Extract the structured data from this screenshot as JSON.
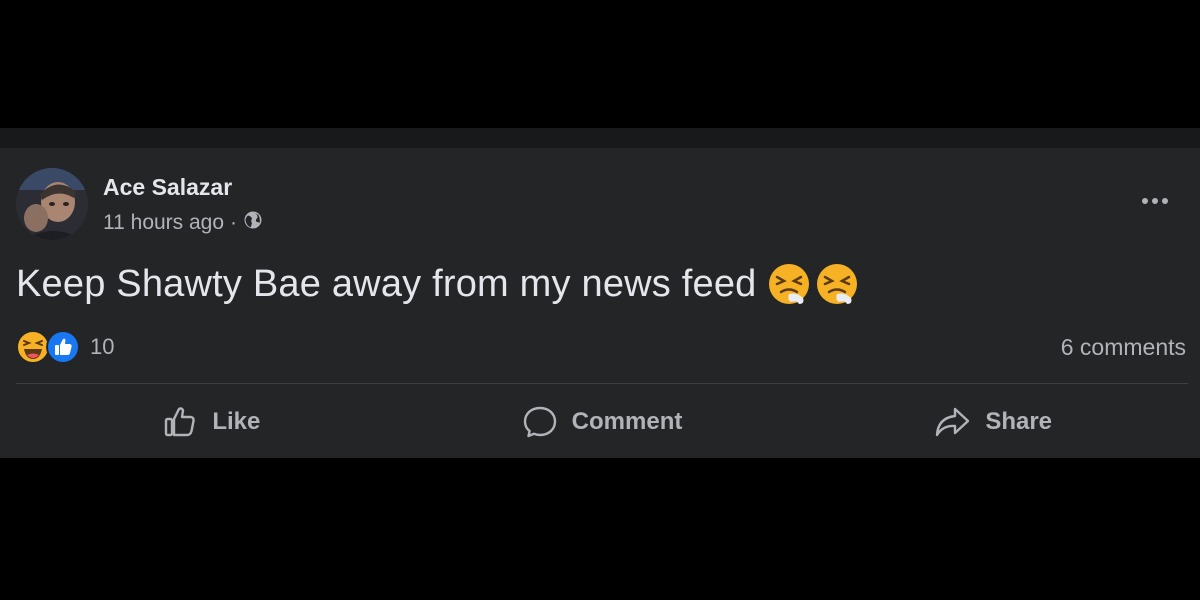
{
  "post": {
    "author": "Ace Salazar",
    "time": "11 hours ago",
    "separator": "·",
    "privacy_icon": "globe-icon",
    "text": "Keep Shawty Bae away from my news feed",
    "text_emojis": [
      "face-with-steam-icon",
      "face-with-steam-icon"
    ],
    "reactions": {
      "icons": [
        "haha-reaction-icon",
        "like-reaction-icon"
      ],
      "count": "10"
    },
    "comments_count": "6 comments",
    "actions": {
      "like": "Like",
      "comment": "Comment",
      "share": "Share"
    }
  },
  "colors": {
    "background": "#000000",
    "card": "#242526",
    "primary_text": "#e4e6eb",
    "secondary_text": "#b0b3b8",
    "like_blue": "#1877f2",
    "haha_yellow": "#f7b125"
  }
}
